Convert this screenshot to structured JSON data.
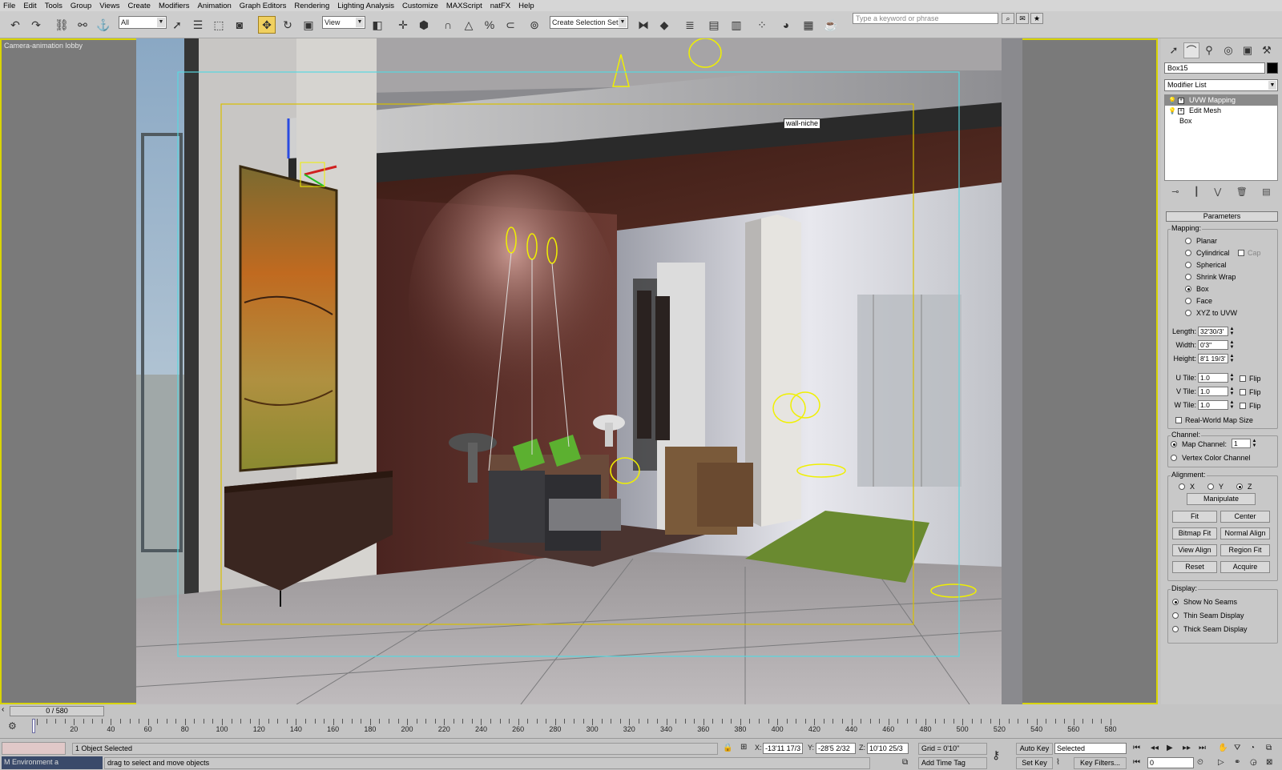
{
  "menu": [
    "File",
    "Edit",
    "Tools",
    "Group",
    "Views",
    "Create",
    "Modifiers",
    "Animation",
    "Graph Editors",
    "Rendering",
    "Lighting Analysis",
    "Customize",
    "MAXScript",
    "natFX",
    "Help"
  ],
  "toolbar": {
    "selection_filter": "All",
    "reference_coord": "View",
    "named_selection_set": "Create Selection Set",
    "search_placeholder": "Type a keyword or phrase"
  },
  "viewport": {
    "label": "Camera-animation lobby",
    "tooltip": "wall-niche"
  },
  "command_panel": {
    "object_name": "Box15",
    "modifier_list": "Modifier List",
    "stack": [
      "UVW Mapping",
      "Edit Mesh",
      "Box"
    ],
    "rollout_title": "Parameters",
    "mapping_title": "Mapping:",
    "mapping_options": [
      "Planar",
      "Cylindrical",
      "Spherical",
      "Shrink Wrap",
      "Box",
      "Face",
      "XYZ to UVW"
    ],
    "mapping_selected": "Box",
    "cap_label": "Cap",
    "length_label": "Length:",
    "length_value": "32'30/3'",
    "width_label": "Width:",
    "width_value": "0'3\"",
    "height_label": "Height:",
    "height_value": "8'1 19/3'",
    "u_tile_label": "U Tile:",
    "v_tile_label": "V Tile:",
    "w_tile_label": "W Tile:",
    "tile_value": "1.0",
    "flip_label": "Flip",
    "real_world": "Real-World Map Size",
    "channel_title": "Channel:",
    "map_channel_label": "Map Channel:",
    "map_channel_value": "1",
    "vertex_color": "Vertex Color Channel",
    "alignment_title": "Alignment:",
    "axes": [
      "X",
      "Y",
      "Z"
    ],
    "axis_selected": "Z",
    "manipulate": "Manipulate",
    "buttons": [
      "Fit",
      "Center",
      "Bitmap Fit",
      "Normal Align",
      "View Align",
      "Region Fit",
      "Reset",
      "Acquire"
    ],
    "display_title": "Display:",
    "display_options": [
      "Show No Seams",
      "Thin Seam Display",
      "Thick Seam Display"
    ],
    "display_selected": "Show No Seams"
  },
  "timeline": {
    "frame_display": "0 / 580",
    "ticks": [
      "20",
      "40",
      "60",
      "80",
      "100",
      "120",
      "140",
      "160",
      "180",
      "200",
      "220",
      "240",
      "260",
      "280",
      "300",
      "320",
      "340",
      "360",
      "380",
      "400",
      "420",
      "440",
      "460",
      "480",
      "500",
      "520",
      "540",
      "560",
      "580"
    ]
  },
  "status": {
    "selection": "1 Object Selected",
    "prompt": "drag to select and move objects",
    "mini_listener": "Environment a",
    "x_label": "X:",
    "x_value": "-13'11 17/3",
    "y_label": "Y:",
    "y_value": "-28'5 2/32",
    "z_label": "Z:",
    "z_value": "10'10 25/3",
    "grid": "Grid = 0'10\"",
    "add_time_tag": "Add Time Tag",
    "auto_key": "Auto Key",
    "set_key": "Set Key",
    "key_mode": "Selected",
    "key_filters": "Key Filters...",
    "current_frame": "0"
  },
  "colors": {
    "viewport_border": "#d8d400",
    "safe_frame": "#58d8e0",
    "render_frame": "#d8c000",
    "light_gizmo": "#f0f000",
    "selection_highlight": "#f0d060"
  }
}
